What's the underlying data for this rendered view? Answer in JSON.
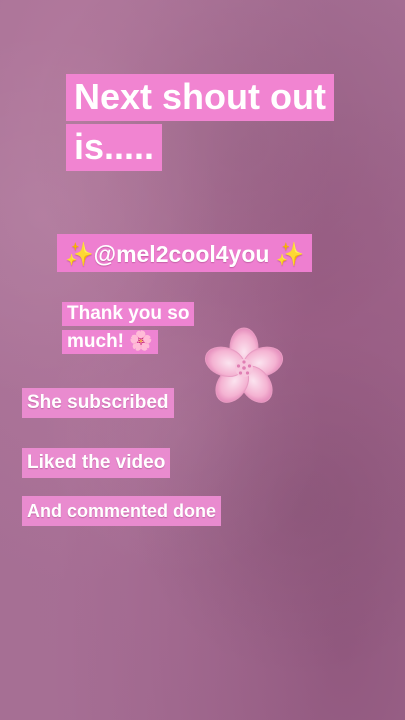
{
  "title": "Next shout out is.....",
  "handle": "✨@mel2cool4you ✨",
  "thanks": "Thank you so much! 🌸",
  "lines": [
    "She subscribed",
    "Liked the video",
    "And commented done"
  ],
  "colors": {
    "background": "#a56f94",
    "label_pink": "#ee7fd0",
    "flower_pink": "#f6b6d6"
  },
  "decoration": {
    "flower_icon": "cherry-blossom-icon"
  }
}
